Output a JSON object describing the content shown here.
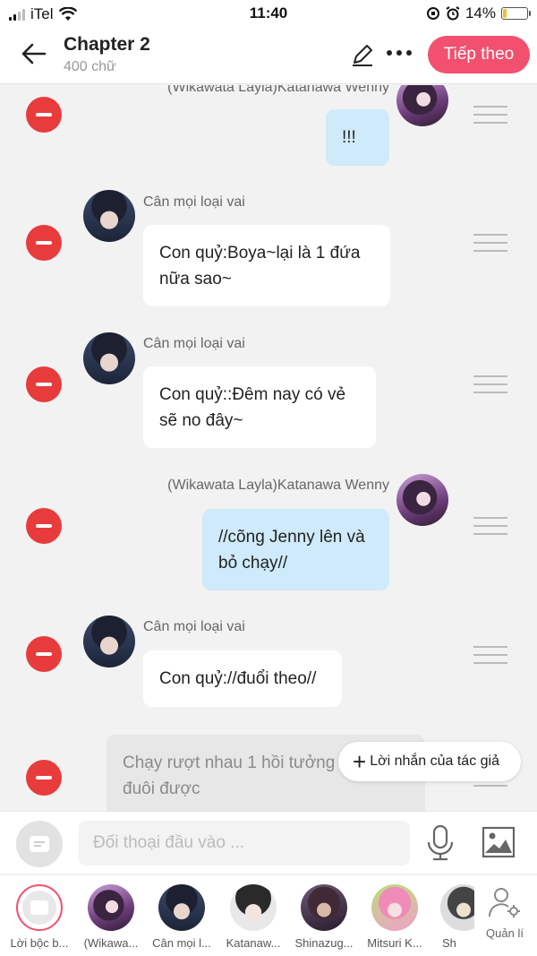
{
  "status_bar": {
    "carrier": "iTel",
    "time": "11:40",
    "battery": "14%",
    "battery_level": 0.14
  },
  "header": {
    "title": "Chapter 2",
    "subtitle": "400 chữ",
    "next_label": "Tiếp theo"
  },
  "messages": [
    {
      "side": "right",
      "name": "(Wikawata Layla)Katanawa Wenny",
      "text": "!!!"
    },
    {
      "side": "left",
      "name": "Cân mọi loại vai",
      "text": "Con quỷ:Boya~lại là 1 đứa nữa sao~"
    },
    {
      "side": "left",
      "name": "Cân mọi loại vai",
      "text": "Con quỷ::Đêm nay có vẻ sẽ no đây~"
    },
    {
      "side": "right",
      "name": "(Wikawata Layla)Katanawa Wenny",
      "text": "//cõng Jenny lên và bỏ chạy//"
    },
    {
      "side": "left",
      "name": "Cân mọi loại vai",
      "text": "Con quỷ://đuổi theo//"
    },
    {
      "side": "narration",
      "name": "",
      "text": "Chạy rượt nhau 1 hồi tưởng đã cắt đuôi được"
    }
  ],
  "author_note": "Lời nhắn của tác giả",
  "input": {
    "placeholder": "Đối thoại đầu vào ..."
  },
  "characters": [
    {
      "label": "Lời bộc b...",
      "avatar": "narrator"
    },
    {
      "label": "(Wikawa...",
      "avatar": "female"
    },
    {
      "label": "Cân mọi l...",
      "avatar": "male"
    },
    {
      "label": "Katanaw...",
      "avatar": "kat"
    },
    {
      "label": "Shinazug...",
      "avatar": "shin"
    },
    {
      "label": "Mitsuri K...",
      "avatar": "mit"
    },
    {
      "label": "Sh",
      "avatar": "sh"
    }
  ],
  "manage_label": "Quản lí",
  "colors": {
    "accent": "#f2506e",
    "remove": "#e83b3b",
    "bubble_right": "#cfeafa",
    "bubble_left": "#ffffff",
    "background": "#f2f2f2"
  }
}
